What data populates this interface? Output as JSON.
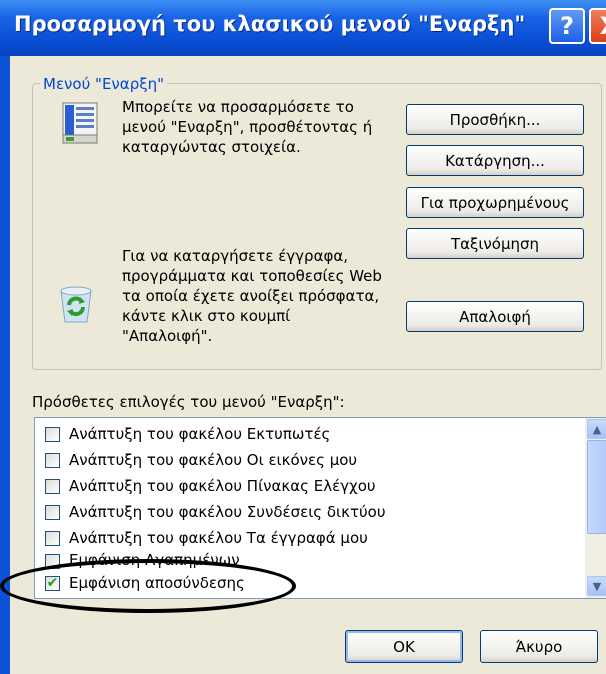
{
  "window": {
    "title": "Προσαρμογή του κλασικού μενού \"Εναρξη\"",
    "help_glyph": "?",
    "close_glyph": "X"
  },
  "group": {
    "legend": "Μενού \"Εναρξη\"",
    "desc1_lines": [
      "Μπορείτε να προσαρμόσετε το",
      "μενού \"Εναρξη\", προσθέτοντας ή",
      "καταργώντας στοιχεία."
    ],
    "desc2_lines": [
      "Για να καταργήσετε έγγραφα,",
      "προγράμματα και τοποθεσίες Web",
      "τα οποία έχετε ανοίξει πρόσφατα,",
      "κάντε κλικ στο κουμπί",
      "\"Απαλοιφή\"."
    ]
  },
  "buttons": {
    "add": "Προσθήκη...",
    "remove": "Κατάργηση...",
    "advanced": "Για προχωρημένους",
    "sort": "Ταξινόμηση",
    "clear": "Απαλοιφή",
    "ok": "OK",
    "cancel": "Άκυρο"
  },
  "options_label": "Πρόσθετες επιλογές του μενού \"Εναρξη\":",
  "options": [
    {
      "label": "Ανάπτυξη του φακέλου Εκτυπωτές",
      "checked": false
    },
    {
      "label": "Ανάπτυξη του φακέλου Οι εικόνες μου",
      "checked": false
    },
    {
      "label": "Ανάπτυξη του φακέλου Πίνακας Ελέγχου",
      "checked": false
    },
    {
      "label": "Ανάπτυξη του φακέλου Συνδέσεις δικτύου",
      "checked": false
    },
    {
      "label": "Ανάπτυξη του φακέλου Τα έγγραφά μου",
      "checked": false
    },
    {
      "label": "Εμφάνιση Αγαπημένων",
      "checked": false
    },
    {
      "label": "Εμφάνιση αποσύνδεσης",
      "checked": true
    }
  ],
  "icons": {
    "menu_icon": "start-menu-list-icon",
    "recycle_icon": "recycle-bin-icon",
    "check_glyph": "✔",
    "scroll_up": "▲",
    "scroll_down": "▼"
  }
}
